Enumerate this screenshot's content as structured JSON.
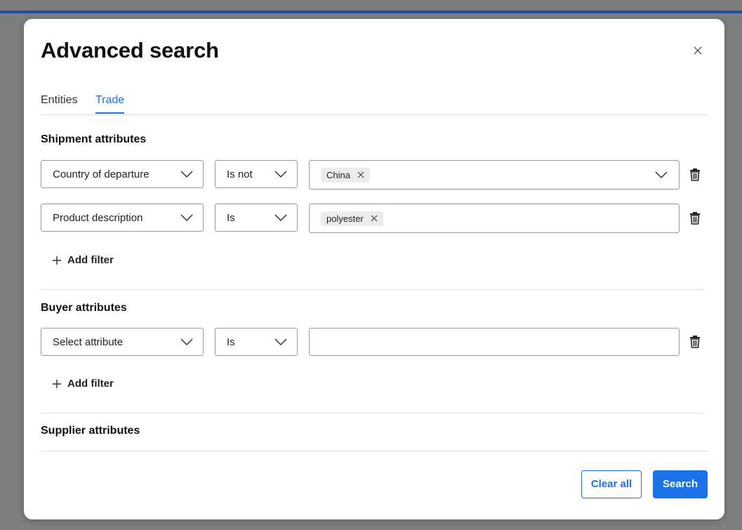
{
  "modal": {
    "title": "Advanced search",
    "tabs": [
      {
        "label": "Entities",
        "active": false
      },
      {
        "label": "Trade",
        "active": true
      }
    ]
  },
  "shipment": {
    "title": "Shipment attributes",
    "filters": [
      {
        "attribute": "Country of departure",
        "operator": "Is not",
        "values": [
          "China"
        ],
        "has_dropdown": true
      },
      {
        "attribute": "Product description",
        "operator": "Is",
        "values": [
          "polyester"
        ],
        "has_dropdown": false
      }
    ],
    "add_filter_label": "Add filter"
  },
  "buyer": {
    "title": "Buyer attributes",
    "filters": [
      {
        "attribute": "Select attribute",
        "operator": "Is",
        "values": []
      }
    ],
    "add_filter_label": "Add filter"
  },
  "supplier": {
    "title": "Supplier attributes"
  },
  "footer": {
    "clear_label": "Clear all",
    "search_label": "Search"
  },
  "colors": {
    "accent": "#1a73e8",
    "top_stripe": "#1f4f9c"
  }
}
